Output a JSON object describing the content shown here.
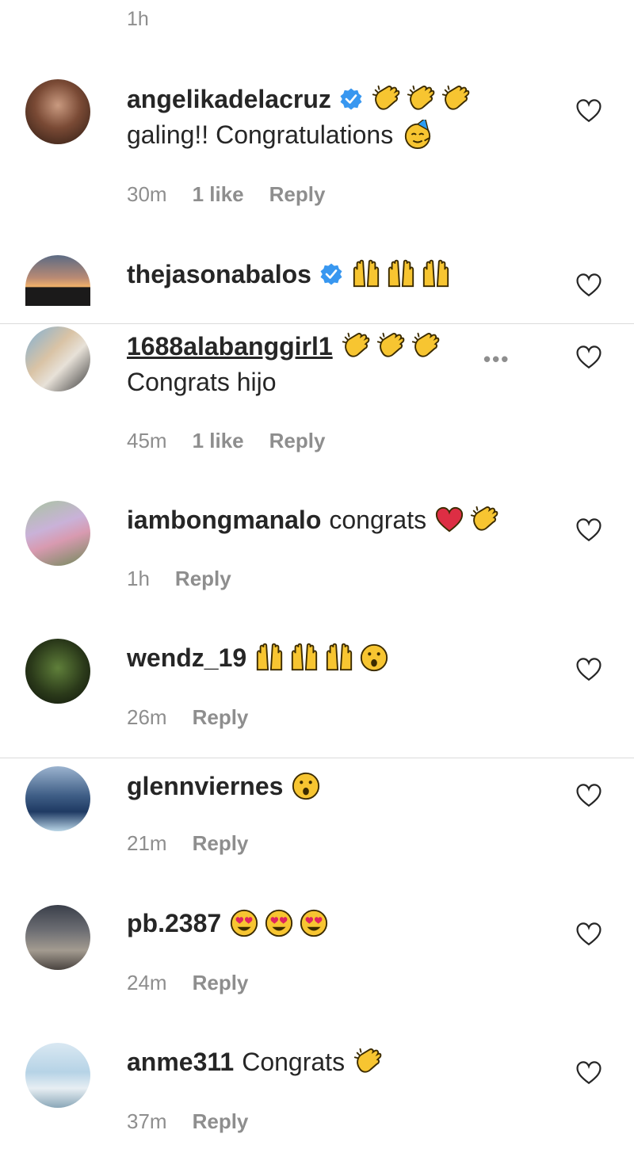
{
  "top_time": "1h",
  "heart_icon": "heart-outline-icon",
  "colors": {
    "verified": "#3897f0",
    "meta": "#8e8e8e",
    "emoji": "#f7c531",
    "heart_red": "#e0245e"
  },
  "comments": [
    {
      "username": "angelikadelacruz",
      "verified": true,
      "emojis_line1": [
        "clapping-hands-emoji",
        "clapping-hands-emoji",
        "clapping-hands-emoji"
      ],
      "text_line2": "galing!! Congratulations",
      "emoji_line2": "partying-face-emoji",
      "time": "30m",
      "likes": "1 like",
      "reply": "Reply"
    },
    {
      "username": "thejasonabalos",
      "verified": true,
      "emojis_line1": [
        "raising-hands-emoji",
        "raising-hands-emoji",
        "raising-hands-emoji"
      ]
    },
    {
      "username": "1688alabanggirl1",
      "emojis_line1": [
        "clapping-hands-emoji",
        "clapping-hands-emoji",
        "clapping-hands-emoji"
      ],
      "text_line2": "Congrats hijo",
      "more": "•••",
      "time": "45m",
      "likes": "1 like",
      "reply": "Reply"
    },
    {
      "username": "iambongmanalo",
      "text": "congrats",
      "emojis_line1": [
        "red-heart-emoji",
        "clapping-hands-emoji"
      ],
      "time": "1h",
      "reply": "Reply"
    },
    {
      "username": "wendz_19",
      "emojis_line1": [
        "raising-hands-emoji",
        "raising-hands-emoji",
        "raising-hands-emoji",
        "surprised-face-emoji"
      ],
      "time": "26m",
      "reply": "Reply"
    },
    {
      "username": "glennviernes",
      "emojis_line1": [
        "surprised-face-emoji"
      ],
      "time": "21m",
      "reply": "Reply"
    },
    {
      "username": "pb.2387",
      "emojis_line1": [
        "heart-eyes-emoji",
        "heart-eyes-emoji",
        "heart-eyes-emoji"
      ],
      "time": "24m",
      "reply": "Reply"
    },
    {
      "username": "anme311",
      "text": "Congrats",
      "emojis_line1": [
        "clapping-hands-emoji"
      ],
      "time": "37m",
      "reply": "Reply"
    }
  ]
}
